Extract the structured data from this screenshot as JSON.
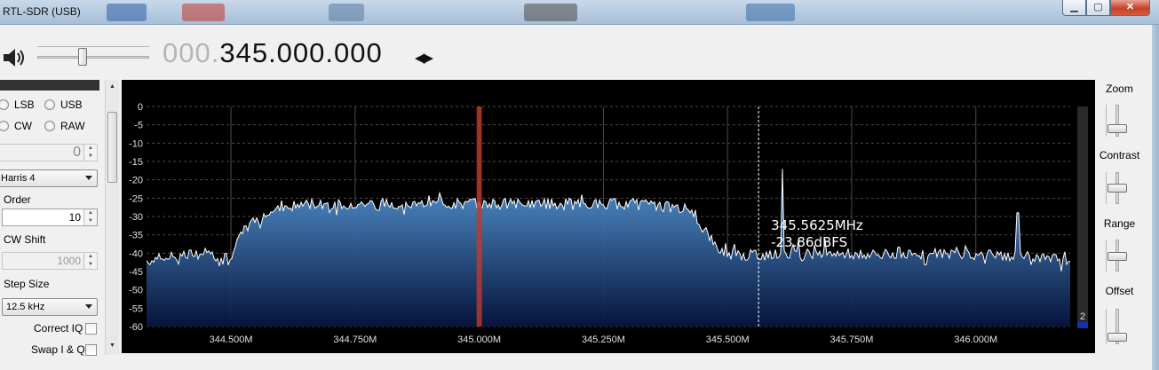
{
  "window": {
    "title": "RTL-SDR (USB)",
    "minimize_glyph": "▁",
    "maximize_glyph": "▢",
    "close_glyph": "✕"
  },
  "top": {
    "speaker_icon": "speaker-icon",
    "volume_level": 0.4,
    "frequency_prefix": "000.",
    "frequency_main": "345.000.000",
    "arrows_glyph": "◀▶"
  },
  "left_panel": {
    "modes": [
      {
        "label": "LSB"
      },
      {
        "label": "USB"
      },
      {
        "label": "CW"
      },
      {
        "label": "RAW"
      }
    ],
    "top_spin_value": "0",
    "window_select": "Harris 4",
    "order_label": "Order",
    "order_value": "10",
    "cw_shift_label": "CW Shift",
    "cw_shift_value": "1000",
    "step_size_label": "Step Size",
    "step_size_value": "12.5 kHz",
    "correct_iq_label": "Correct IQ",
    "swap_iq_label": "Swap I & Q"
  },
  "right_panel": {
    "zoom_label": "Zoom",
    "zoom_level": 0.15,
    "contrast_label": "Contrast",
    "contrast_level": 0.5,
    "range_label": "Range",
    "range_level": 0.45,
    "offset_label": "Offset",
    "offset_level": 0.1
  },
  "chart_data": {
    "type": "area",
    "xlim": [
      344.33,
      346.19
    ],
    "ylim": [
      -60,
      0
    ],
    "x_ticks": [
      344.5,
      344.75,
      345.0,
      345.25,
      345.5,
      345.75,
      346.0
    ],
    "x_tick_labels": [
      "344.500M",
      "344.750M",
      "345.000M",
      "345.250M",
      "345.500M",
      "345.750M",
      "346.000M"
    ],
    "y_ticks": [
      0,
      -5,
      -10,
      -15,
      -20,
      -25,
      -30,
      -35,
      -40,
      -45,
      -50,
      -55,
      -60
    ],
    "y_tick_labels": [
      "0",
      "-5",
      "-10",
      "-15",
      "-20",
      "-25",
      "-30",
      "-35",
      "-40",
      "-45",
      "-50",
      "-55",
      "-60"
    ],
    "grid": true,
    "series": [
      {
        "x": [
          344.33,
          344.38,
          344.43,
          344.48,
          344.5,
          344.53,
          344.56,
          344.6,
          344.65,
          344.7,
          344.8,
          344.9,
          345.0,
          345.1,
          345.2,
          345.3,
          345.36,
          345.42,
          345.44,
          345.47,
          345.5,
          345.55,
          345.6,
          345.7,
          345.8,
          345.9,
          346.0,
          346.1,
          346.19
        ],
        "values": [
          -42,
          -41,
          -40,
          -41,
          -40.5,
          -33,
          -30,
          -28,
          -26.5,
          -26.5,
          -26.5,
          -26.5,
          -26.5,
          -26.5,
          -26.5,
          -26.5,
          -27,
          -28,
          -31,
          -37,
          -40.5,
          -40.5,
          -40.5,
          -40,
          -40.5,
          -40,
          -40.5,
          -41,
          -42
        ]
      }
    ],
    "spikes": [
      {
        "x": 345.61,
        "y": -17
      },
      {
        "x": 346.085,
        "y": -29
      },
      {
        "x": 345.98,
        "y": -38
      }
    ],
    "center_marker_x": 345.0,
    "cursor": {
      "x": 345.5625,
      "freq_label": "345.5625MHz",
      "level_label": "-23.86dBFS"
    },
    "colorbar_label": "2",
    "colors": {
      "fill_top": "#5aa0e0",
      "fill_bottom": "#06153f",
      "trace": "#ffffff",
      "marker": "#c0392b"
    }
  }
}
